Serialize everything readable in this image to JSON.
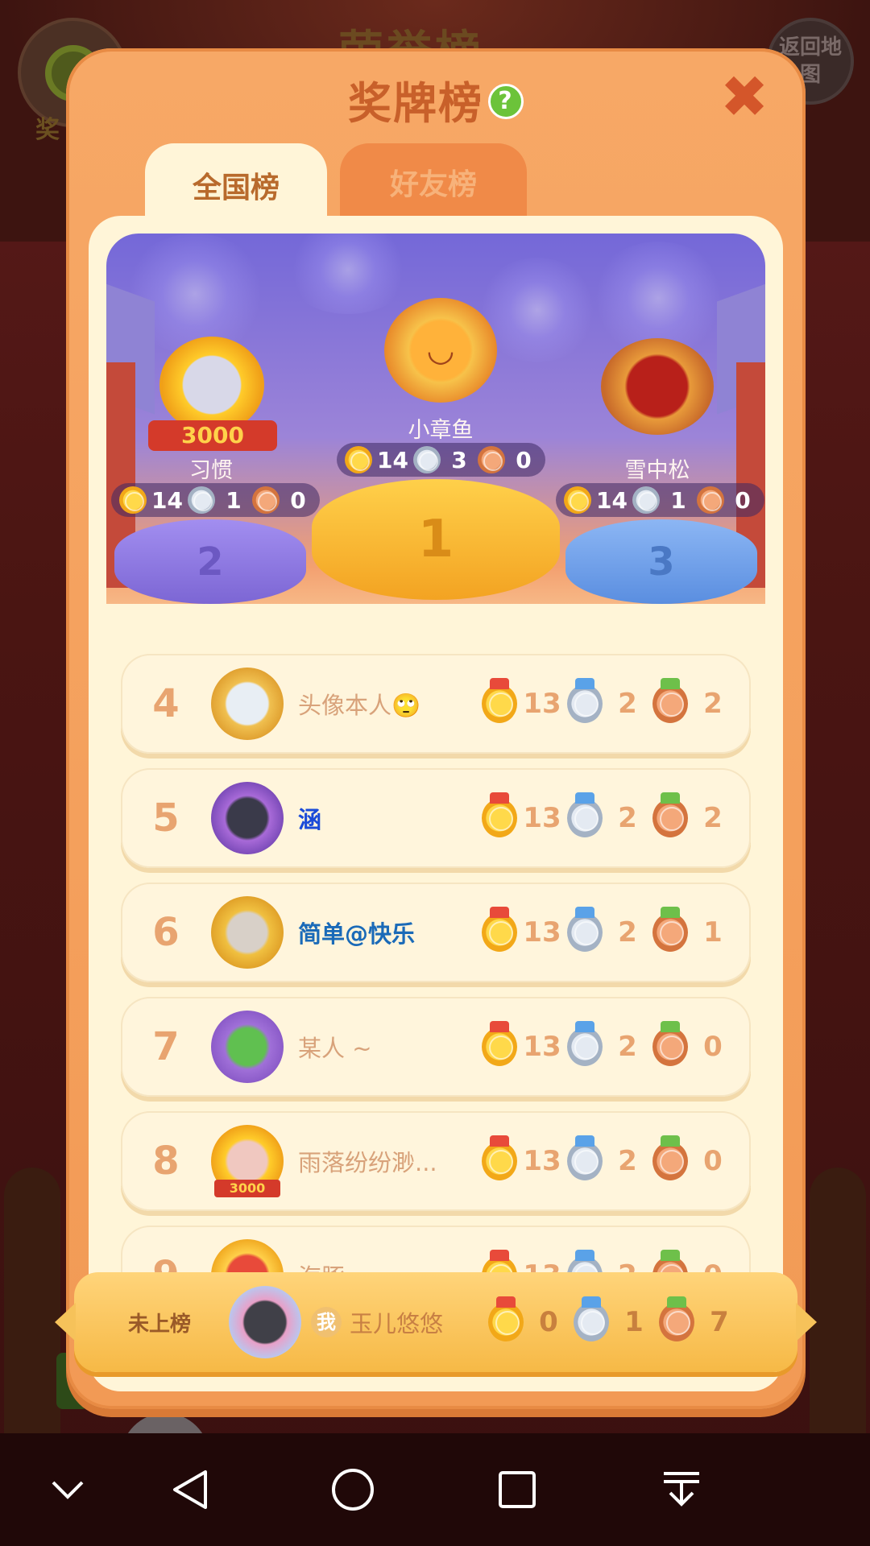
{
  "background": {
    "title": "荣誉榜",
    "left_button_label": "奖",
    "right_button_label": "返回地图"
  },
  "modal": {
    "title": "奖牌榜",
    "help_glyph": "?",
    "close_glyph": "✖",
    "tabs": [
      {
        "label": "全国榜",
        "active": true
      },
      {
        "label": "好友榜",
        "active": false
      }
    ]
  },
  "podium": [
    {
      "rank": "1",
      "name": "小章鱼",
      "gold": "14",
      "silver": "3",
      "bronze": "0"
    },
    {
      "rank": "2",
      "name": "习惯",
      "gold": "14",
      "silver": "1",
      "bronze": "0",
      "badge": "3000"
    },
    {
      "rank": "3",
      "name": "雪中松",
      "gold": "14",
      "silver": "1",
      "bronze": "0"
    }
  ],
  "rankings": [
    {
      "rank": "4",
      "name": "头像本人🙄",
      "gold": "13",
      "silver": "2",
      "bronze": "2"
    },
    {
      "rank": "5",
      "name": "涵",
      "gold": "13",
      "silver": "2",
      "bronze": "2"
    },
    {
      "rank": "6",
      "name": "简单@快乐",
      "gold": "13",
      "silver": "2",
      "bronze": "1"
    },
    {
      "rank": "7",
      "name": "某人 ~",
      "gold": "13",
      "silver": "2",
      "bronze": "0"
    },
    {
      "rank": "8",
      "name": "雨落纷纷渺...",
      "gold": "13",
      "silver": "2",
      "bronze": "0",
      "badge": "3000"
    },
    {
      "rank": "9",
      "name": "海豚",
      "gold": "13",
      "silver": "2",
      "bronze": "0"
    }
  ],
  "me": {
    "status": "未上榜",
    "tag": "我",
    "name": "玉儿悠悠",
    "gold": "0",
    "silver": "1",
    "bronze": "7"
  },
  "colors": {
    "modal_orange": "#f7a866",
    "panel_cream": "#fff5d8",
    "rank_number": "#e8a470",
    "gold_medal": "#ffd94a",
    "silver_medal": "#e4eaf2",
    "bronze_medal": "#f4a87a",
    "help_green": "#6cc33a",
    "close_red": "#d4562a"
  },
  "icons": {
    "help": "question-icon",
    "close": "close-icon",
    "nav": [
      "chevron-down-icon",
      "back-triangle-icon",
      "home-circle-icon",
      "recents-square-icon",
      "download-tray-icon"
    ]
  }
}
